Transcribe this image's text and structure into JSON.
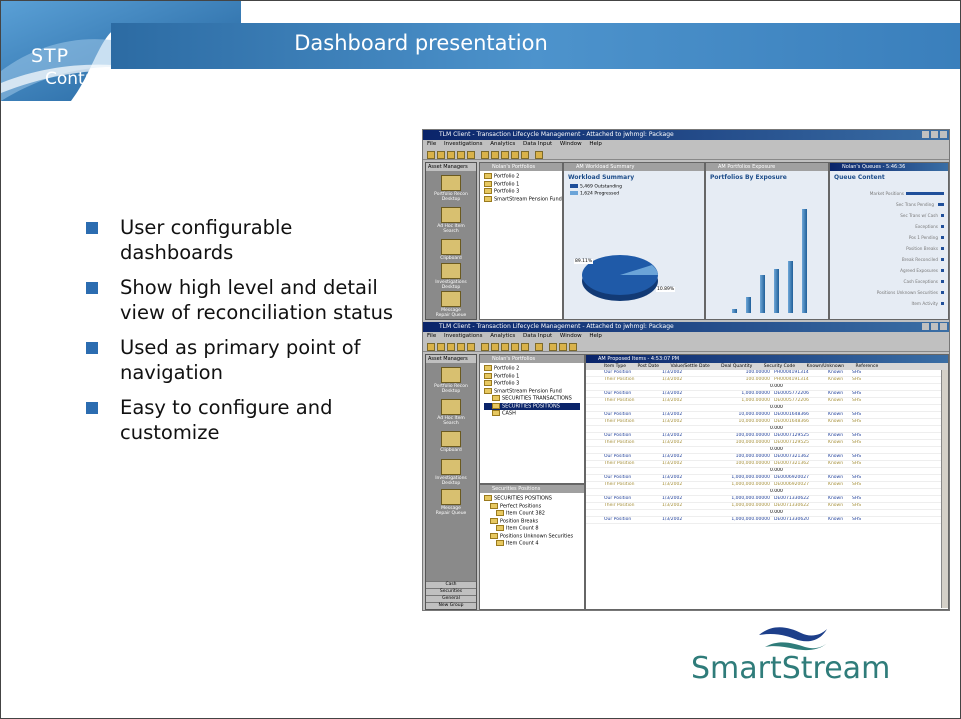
{
  "header": {
    "title": "Dashboard presentation",
    "logo_line1": "STP",
    "logo_line2": "Control"
  },
  "bullets": [
    "User configurable dashboards",
    "Show high level and detail view of reconciliation status",
    "Used as primary point of navigation",
    "Easy to configure and customize"
  ],
  "brand": {
    "name": "SmartStream",
    "color": "#2f7c7a",
    "accent": "#2b6cb0"
  },
  "screenshot": {
    "top_window": {
      "title": "TLM Client - Transaction Lifecycle Management - Attached to jwhmgl: Package",
      "menu": [
        "File",
        "Investigations",
        "Analytics",
        "Data Input",
        "Window",
        "Help"
      ],
      "nav_title": "Asset Managers",
      "nav_items": [
        "Portfolio Recon Desktop",
        "Ad Hoc Item Search",
        "Clipboard",
        "Investigations Desktop",
        "Message Repair Queue"
      ],
      "portfolio_pane_title": "Nolan's Portfolios",
      "portfolios": [
        "Portfolio 2",
        "Portfolio 1",
        "Portfolio 3",
        "SmartStream Pension Fund"
      ],
      "workload_pane_title": "AM Workload Summary",
      "workload_heading": "Workload Summary",
      "workload_legend": [
        "5,469 Outstanding",
        "1,624 Progressed"
      ],
      "workload_labels": [
        "89.11%",
        "10.89%"
      ],
      "exposure_pane_title": "AM Portfolios Exposure",
      "exposure_heading": "Portfolios By Exposure",
      "queues_pane_title": "Nolan's Queues - 5:46:36",
      "queues_heading": "Queue Content",
      "queue_rows": [
        "Market Positions",
        "Sec Trans Pending",
        "Sec Trans w/ Cash",
        "Exceptions",
        "Pos 1 Pending",
        "Position Breaks",
        "Break Reconciled",
        "Agreed Exposures",
        "Cash Exceptions",
        "Positions Unknown Securities",
        "Item Activity"
      ]
    },
    "bottom_window": {
      "title": "TLM Client - Transaction Lifecycle Management - Attached to jwhmgl: Package",
      "menu": [
        "File",
        "Investigations",
        "Analytics",
        "Data Input",
        "Window",
        "Help"
      ],
      "nav_title": "Asset Managers",
      "nav_items": [
        "Portfolio Recon Desktop",
        "Ad Hoc Item Search",
        "Clipboard",
        "Investigations Desktop",
        "Message Repair Queue"
      ],
      "nav_footer": [
        "Cash",
        "Securities",
        "General",
        "New Group"
      ],
      "portfolio_pane_title": "Nolan's Portfolios",
      "portfolios": [
        "Portfolio 2",
        "Portfolio 1",
        "Portfolio 3",
        "SmartStream Pension Fund",
        "SECURITIES TRANSACTIONS",
        "SECURITIES POSITIONS",
        "CASH"
      ],
      "positions_pane_title": "Securities Positions",
      "positions_tree": [
        "SECURITIES POSITIONS",
        "Perfect Positions",
        "Item Count 382",
        "Position Breaks",
        "Item Count 8",
        "Positions Unknown Securities",
        "Item Count 4"
      ],
      "grid_title": "AM Proposed Items - 4:53:07 PM",
      "grid_columns": [
        "Item Type",
        "Post Date",
        "Value/Settle Date",
        "Deal Quantity",
        "Security Code",
        "Known/Unknown",
        "Reference"
      ],
      "grid_rows": [
        [
          "Our Position",
          "1/3/2002",
          "100.00000",
          "PH0004191314",
          "Known",
          "SHS"
        ],
        [
          "Their Position",
          "1/3/2002",
          "100.00000",
          "PH0004191314",
          "Known",
          "SHS"
        ],
        [
          "Our Position",
          "1/3/2002",
          "1,000.00000",
          "DE0005772206",
          "Known",
          "SHS"
        ],
        [
          "Their Position",
          "1/3/2002",
          "1,000.00000",
          "DE0005772206",
          "Known",
          "SHS"
        ],
        [
          "Our Position",
          "1/3/2002",
          "10,000.00000",
          "DE0001648366",
          "Known",
          "SHS"
        ],
        [
          "Their Position",
          "1/3/2002",
          "10,000.00000",
          "DE0001648366",
          "Known",
          "SHS"
        ],
        [
          "Our Position",
          "1/3/2002",
          "100,000.00000",
          "DE0007129525",
          "Known",
          "SHS"
        ],
        [
          "Their Position",
          "1/3/2002",
          "100,000.00000",
          "DE0007129525",
          "Known",
          "SHS"
        ],
        [
          "Our Position",
          "1/3/2002",
          "100,000.00000",
          "DE0007321362",
          "Known",
          "SHS"
        ],
        [
          "Their Position",
          "1/3/2002",
          "100,000.00000",
          "DE0007321362",
          "Known",
          "SHS"
        ],
        [
          "Our Position",
          "1/3/2002",
          "1,000,000.00000",
          "DE0006920027",
          "Known",
          "SHS"
        ],
        [
          "Their Position",
          "1/3/2002",
          "1,000,000.00000",
          "DE0006920027",
          "Known",
          "SHS"
        ],
        [
          "Our Position",
          "1/3/2002",
          "1,000,000.00000",
          "DE0071330622",
          "Known",
          "SHS"
        ],
        [
          "Their Position",
          "1/3/2002",
          "1,000,000.00000",
          "DE0071330622",
          "Known",
          "SHS"
        ],
        [
          "Our Position",
          "1/3/2002",
          "1,000,000.00000",
          "DE0071330620",
          "Known",
          "SHS"
        ]
      ],
      "grid_diff": "0.000"
    }
  }
}
